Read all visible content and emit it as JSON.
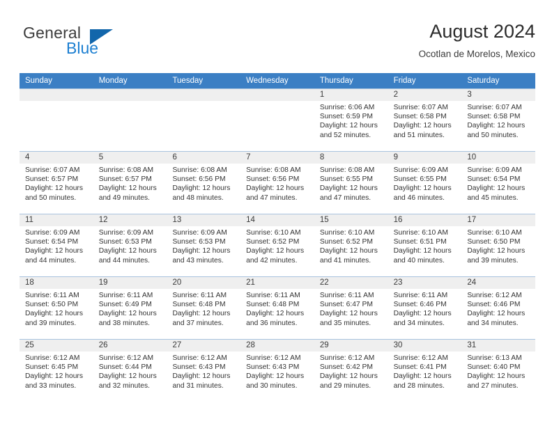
{
  "brand": {
    "name_primary": "General",
    "name_secondary": "Blue",
    "primary_color": "#3c3c3c",
    "secondary_color": "#1c7fd1",
    "triangle_color": "#1266ab"
  },
  "header": {
    "title": "August 2024",
    "subtitle": "Ocotlan de Morelos, Mexico"
  },
  "calendar": {
    "header_bg": "#3b7fc4",
    "header_text_color": "#ffffff",
    "daynum_band_bg": "#efefef",
    "weekday_headers": [
      "Sunday",
      "Monday",
      "Tuesday",
      "Wednesday",
      "Thursday",
      "Friday",
      "Saturday"
    ],
    "weeks": [
      [
        {
          "day": "",
          "sunrise": "",
          "sunset": "",
          "daylight_line1": "",
          "daylight_line2": ""
        },
        {
          "day": "",
          "sunrise": "",
          "sunset": "",
          "daylight_line1": "",
          "daylight_line2": ""
        },
        {
          "day": "",
          "sunrise": "",
          "sunset": "",
          "daylight_line1": "",
          "daylight_line2": ""
        },
        {
          "day": "",
          "sunrise": "",
          "sunset": "",
          "daylight_line1": "",
          "daylight_line2": ""
        },
        {
          "day": "1",
          "sunrise": "Sunrise: 6:06 AM",
          "sunset": "Sunset: 6:59 PM",
          "daylight_line1": "Daylight: 12 hours",
          "daylight_line2": "and 52 minutes."
        },
        {
          "day": "2",
          "sunrise": "Sunrise: 6:07 AM",
          "sunset": "Sunset: 6:58 PM",
          "daylight_line1": "Daylight: 12 hours",
          "daylight_line2": "and 51 minutes."
        },
        {
          "day": "3",
          "sunrise": "Sunrise: 6:07 AM",
          "sunset": "Sunset: 6:58 PM",
          "daylight_line1": "Daylight: 12 hours",
          "daylight_line2": "and 50 minutes."
        }
      ],
      [
        {
          "day": "4",
          "sunrise": "Sunrise: 6:07 AM",
          "sunset": "Sunset: 6:57 PM",
          "daylight_line1": "Daylight: 12 hours",
          "daylight_line2": "and 50 minutes."
        },
        {
          "day": "5",
          "sunrise": "Sunrise: 6:08 AM",
          "sunset": "Sunset: 6:57 PM",
          "daylight_line1": "Daylight: 12 hours",
          "daylight_line2": "and 49 minutes."
        },
        {
          "day": "6",
          "sunrise": "Sunrise: 6:08 AM",
          "sunset": "Sunset: 6:56 PM",
          "daylight_line1": "Daylight: 12 hours",
          "daylight_line2": "and 48 minutes."
        },
        {
          "day": "7",
          "sunrise": "Sunrise: 6:08 AM",
          "sunset": "Sunset: 6:56 PM",
          "daylight_line1": "Daylight: 12 hours",
          "daylight_line2": "and 47 minutes."
        },
        {
          "day": "8",
          "sunrise": "Sunrise: 6:08 AM",
          "sunset": "Sunset: 6:55 PM",
          "daylight_line1": "Daylight: 12 hours",
          "daylight_line2": "and 47 minutes."
        },
        {
          "day": "9",
          "sunrise": "Sunrise: 6:09 AM",
          "sunset": "Sunset: 6:55 PM",
          "daylight_line1": "Daylight: 12 hours",
          "daylight_line2": "and 46 minutes."
        },
        {
          "day": "10",
          "sunrise": "Sunrise: 6:09 AM",
          "sunset": "Sunset: 6:54 PM",
          "daylight_line1": "Daylight: 12 hours",
          "daylight_line2": "and 45 minutes."
        }
      ],
      [
        {
          "day": "11",
          "sunrise": "Sunrise: 6:09 AM",
          "sunset": "Sunset: 6:54 PM",
          "daylight_line1": "Daylight: 12 hours",
          "daylight_line2": "and 44 minutes."
        },
        {
          "day": "12",
          "sunrise": "Sunrise: 6:09 AM",
          "sunset": "Sunset: 6:53 PM",
          "daylight_line1": "Daylight: 12 hours",
          "daylight_line2": "and 44 minutes."
        },
        {
          "day": "13",
          "sunrise": "Sunrise: 6:09 AM",
          "sunset": "Sunset: 6:53 PM",
          "daylight_line1": "Daylight: 12 hours",
          "daylight_line2": "and 43 minutes."
        },
        {
          "day": "14",
          "sunrise": "Sunrise: 6:10 AM",
          "sunset": "Sunset: 6:52 PM",
          "daylight_line1": "Daylight: 12 hours",
          "daylight_line2": "and 42 minutes."
        },
        {
          "day": "15",
          "sunrise": "Sunrise: 6:10 AM",
          "sunset": "Sunset: 6:52 PM",
          "daylight_line1": "Daylight: 12 hours",
          "daylight_line2": "and 41 minutes."
        },
        {
          "day": "16",
          "sunrise": "Sunrise: 6:10 AM",
          "sunset": "Sunset: 6:51 PM",
          "daylight_line1": "Daylight: 12 hours",
          "daylight_line2": "and 40 minutes."
        },
        {
          "day": "17",
          "sunrise": "Sunrise: 6:10 AM",
          "sunset": "Sunset: 6:50 PM",
          "daylight_line1": "Daylight: 12 hours",
          "daylight_line2": "and 39 minutes."
        }
      ],
      [
        {
          "day": "18",
          "sunrise": "Sunrise: 6:11 AM",
          "sunset": "Sunset: 6:50 PM",
          "daylight_line1": "Daylight: 12 hours",
          "daylight_line2": "and 39 minutes."
        },
        {
          "day": "19",
          "sunrise": "Sunrise: 6:11 AM",
          "sunset": "Sunset: 6:49 PM",
          "daylight_line1": "Daylight: 12 hours",
          "daylight_line2": "and 38 minutes."
        },
        {
          "day": "20",
          "sunrise": "Sunrise: 6:11 AM",
          "sunset": "Sunset: 6:48 PM",
          "daylight_line1": "Daylight: 12 hours",
          "daylight_line2": "and 37 minutes."
        },
        {
          "day": "21",
          "sunrise": "Sunrise: 6:11 AM",
          "sunset": "Sunset: 6:48 PM",
          "daylight_line1": "Daylight: 12 hours",
          "daylight_line2": "and 36 minutes."
        },
        {
          "day": "22",
          "sunrise": "Sunrise: 6:11 AM",
          "sunset": "Sunset: 6:47 PM",
          "daylight_line1": "Daylight: 12 hours",
          "daylight_line2": "and 35 minutes."
        },
        {
          "day": "23",
          "sunrise": "Sunrise: 6:11 AM",
          "sunset": "Sunset: 6:46 PM",
          "daylight_line1": "Daylight: 12 hours",
          "daylight_line2": "and 34 minutes."
        },
        {
          "day": "24",
          "sunrise": "Sunrise: 6:12 AM",
          "sunset": "Sunset: 6:46 PM",
          "daylight_line1": "Daylight: 12 hours",
          "daylight_line2": "and 34 minutes."
        }
      ],
      [
        {
          "day": "25",
          "sunrise": "Sunrise: 6:12 AM",
          "sunset": "Sunset: 6:45 PM",
          "daylight_line1": "Daylight: 12 hours",
          "daylight_line2": "and 33 minutes."
        },
        {
          "day": "26",
          "sunrise": "Sunrise: 6:12 AM",
          "sunset": "Sunset: 6:44 PM",
          "daylight_line1": "Daylight: 12 hours",
          "daylight_line2": "and 32 minutes."
        },
        {
          "day": "27",
          "sunrise": "Sunrise: 6:12 AM",
          "sunset": "Sunset: 6:43 PM",
          "daylight_line1": "Daylight: 12 hours",
          "daylight_line2": "and 31 minutes."
        },
        {
          "day": "28",
          "sunrise": "Sunrise: 6:12 AM",
          "sunset": "Sunset: 6:43 PM",
          "daylight_line1": "Daylight: 12 hours",
          "daylight_line2": "and 30 minutes."
        },
        {
          "day": "29",
          "sunrise": "Sunrise: 6:12 AM",
          "sunset": "Sunset: 6:42 PM",
          "daylight_line1": "Daylight: 12 hours",
          "daylight_line2": "and 29 minutes."
        },
        {
          "day": "30",
          "sunrise": "Sunrise: 6:12 AM",
          "sunset": "Sunset: 6:41 PM",
          "daylight_line1": "Daylight: 12 hours",
          "daylight_line2": "and 28 minutes."
        },
        {
          "day": "31",
          "sunrise": "Sunrise: 6:13 AM",
          "sunset": "Sunset: 6:40 PM",
          "daylight_line1": "Daylight: 12 hours",
          "daylight_line2": "and 27 minutes."
        }
      ]
    ]
  }
}
